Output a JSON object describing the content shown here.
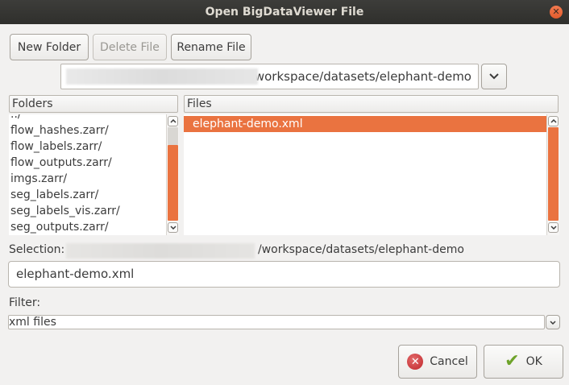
{
  "window": {
    "title": "Open BigDataViewer File"
  },
  "toolbar": {
    "new_folder": "New Folder",
    "delete_file": "Delete File",
    "rename_file": "Rename File"
  },
  "path": {
    "value": "/workspace/datasets/elephant-demo"
  },
  "folders": {
    "header": "Folders",
    "items": [
      "../",
      "flow_hashes.zarr/",
      "flow_labels.zarr/",
      "flow_outputs.zarr/",
      "imgs.zarr/",
      "seg_labels.zarr/",
      "seg_labels_vis.zarr/",
      "seg_outputs.zarr/"
    ],
    "scroll_fraction": 0.6
  },
  "files": {
    "header": "Files",
    "items": [
      "elephant-demo.xml"
    ],
    "selected_index": 0
  },
  "selection": {
    "label": "Selection:",
    "path": "/workspace/datasets/elephant-demo",
    "entry_value": "elephant-demo.xml"
  },
  "filter": {
    "label": "Filter:",
    "value": "xml files"
  },
  "actions": {
    "cancel": "Cancel",
    "ok": "OK"
  },
  "colors": {
    "accent": "#ea7340",
    "titlebar": "#3d3d3a",
    "background": "#f2f1f0"
  }
}
